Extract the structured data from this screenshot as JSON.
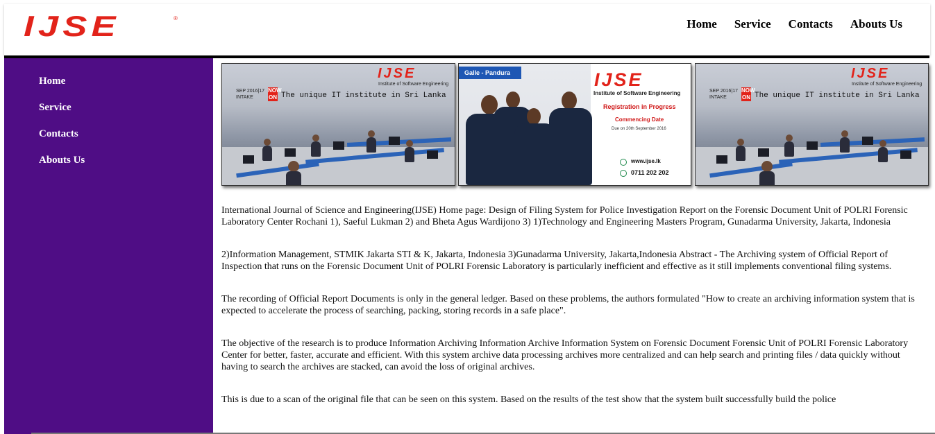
{
  "header": {
    "logo_text": "IJSE",
    "nav": [
      "Home",
      "Service",
      "Contacts",
      "Abouts Us"
    ]
  },
  "sidebar": {
    "items": [
      "Home",
      "Service",
      "Contacts",
      "Abouts Us"
    ],
    "background": "#4f0d85"
  },
  "gallery": {
    "slides": [
      {
        "logo": "IJSE",
        "subtitle": "Institute of Software Engineering",
        "intake": "SEP 2016|17",
        "intake_label": "INTAKE",
        "now_on": "NOW ON",
        "tagline": "The unique IT institute in Sri Lanka"
      },
      {
        "place": "Galle - Pandura",
        "logo": "IJSE",
        "subtitle": "Institute of Software Engineering",
        "status": "Registration in Progress",
        "commencing": "Commencing Date",
        "due": "Due on 20th September 2016",
        "website": "www.ijse.lk",
        "phone": "0711 202 202"
      },
      {
        "logo": "IJSE",
        "subtitle": "Institute of Software Engineering",
        "intake": "SEP 2016|17",
        "intake_label": "INTAKE",
        "now_on": "NOW ON",
        "tagline": "The unique IT institute in Sri Lanka"
      }
    ]
  },
  "content": {
    "paragraphs": [
      "International Journal of Science and Engineering(IJSE) Home page: Design of Filing System for Police Investigation Report on the Forensic Document Unit of POLRI Forensic Laboratory Center Rochani 1), Saeful Lukman 2) and Bheta Agus Wardijono 3) 1)Technology and Engineering Masters Program, Gunadarma University, Jakarta, Indonesia",
      "2)Information Management, STMIK Jakarta STI & K, Jakarta, Indonesia 3)Gunadarma University, Jakarta,Indonesia Abstract - The Archiving system of Official Report of Inspection that runs on the Forensic Document Unit of POLRI Forensic Laboratory is particularly inefficient and effective as it still implements conventional filing systems.",
      "The recording of Official Report Documents is only in the general ledger. Based on these problems, the authors formulated \"How to create an archiving information system that is expected to accelerate the process of searching, packing, storing records in a safe place\".",
      "The objective of the research is to produce Information Archiving Information Archive Information System on Forensic Document Forensic Unit of POLRI Forensic Laboratory Center for better, faster, accurate and efficient. With this system archive data processing archives more centralized and can help search and printing files / data quickly without having to search the archives are stacked, can avoid the loss of original archives.",
      "This is due to a scan of the original file that can be seen on this system. Based on the results of the test show that the system built successfully build the police"
    ]
  }
}
